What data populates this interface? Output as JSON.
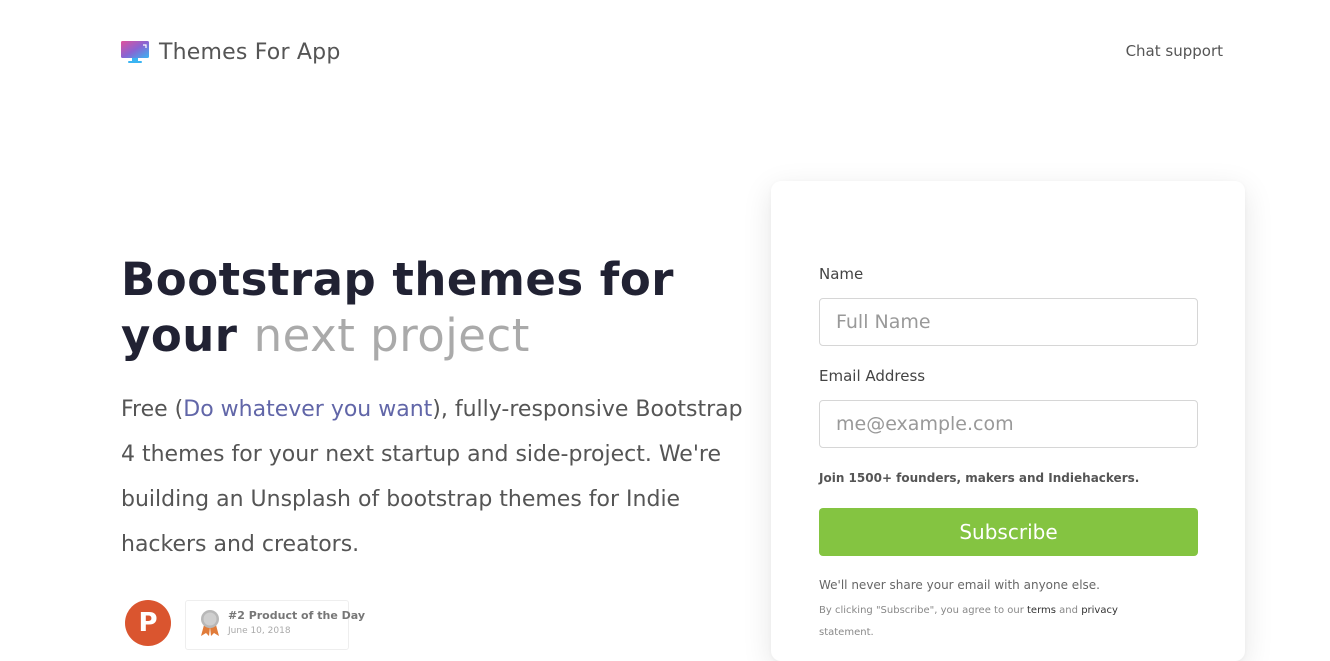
{
  "header": {
    "brand_name": "Themes For App",
    "brand_icon": "monitor-icon",
    "chat_support_label": "Chat support"
  },
  "hero": {
    "title_part1": "Bootstrap themes for",
    "title_part2": "your",
    "title_part3": "next project",
    "desc_prefix": "Free (",
    "desc_link": "Do whatever you want",
    "desc_suffix": "), fully-responsive Bootstrap 4 themes for your next startup and side-project. We're building an Unsplash of bootstrap themes for Indie hackers and creators."
  },
  "badge": {
    "logo_letter": "P",
    "logo_icon": "product-hunt-icon",
    "medal_icon": "medal-icon",
    "medal_rank": "2",
    "title": "#2 Product of the Day",
    "date": "June 10, 2018"
  },
  "form": {
    "name_label": "Name",
    "name_placeholder": "Full Name",
    "email_label": "Email Address",
    "email_placeholder": "me@example.com",
    "join_text": "Join 1500+ founders, makers and Indiehackers.",
    "subscribe_label": "Subscribe",
    "privacy_note": "We'll never share your email with anyone else.",
    "terms_prefix": "By clicking \"Subscribe\", you agree to our",
    "terms_link": "terms",
    "terms_and": "and",
    "privacy_link": "privacy",
    "terms_suffix": "statement."
  },
  "colors": {
    "accent_green": "#84c441",
    "link_purple": "#6166a8",
    "title_dark": "#212233",
    "product_hunt_orange": "#da552f"
  }
}
